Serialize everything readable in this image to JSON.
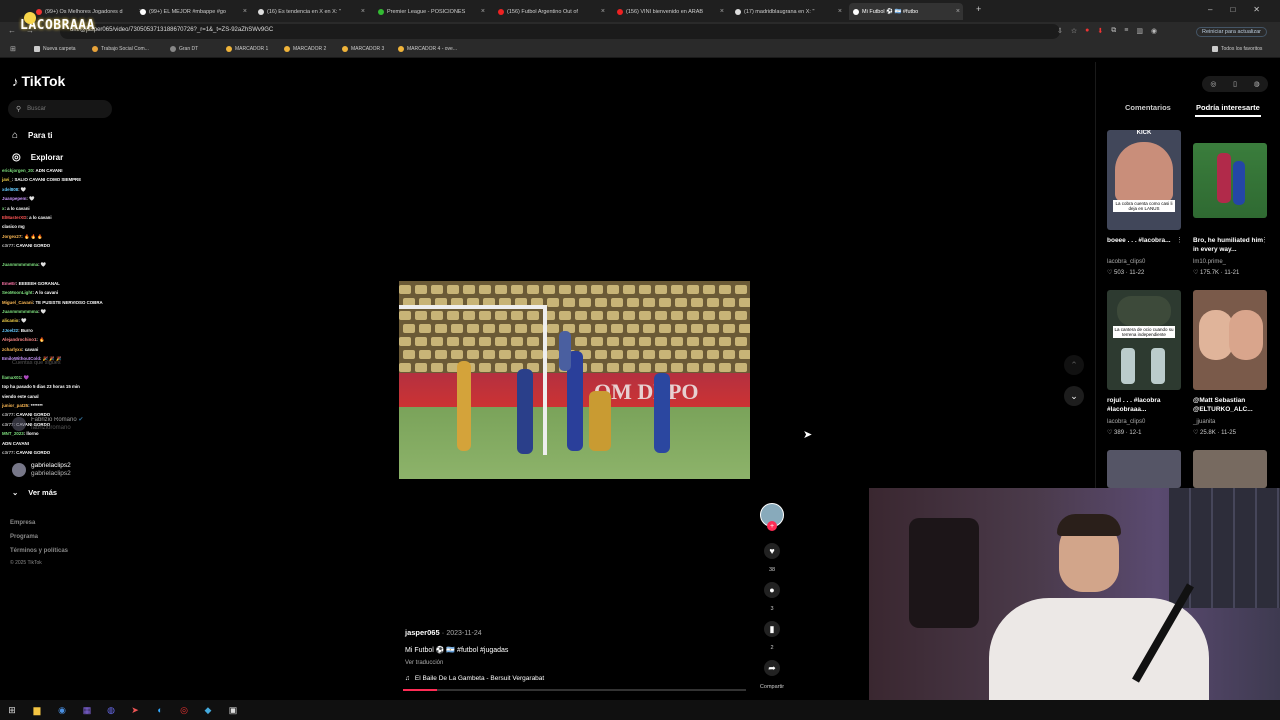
{
  "browser": {
    "tabs": [
      {
        "label": "(99+) Os Melhores Jogadores d",
        "color": "#e33"
      },
      {
        "label": "(99+) EL MEJOR #mbappe #go",
        "color": "#fff"
      },
      {
        "label": "(16) Es tendencia en X en X: \"",
        "color": "#ddd"
      },
      {
        "label": "Premier League - POSICIONES",
        "color": "#3b3"
      },
      {
        "label": "(156) Futbol Argentino Out of",
        "color": "#e22"
      },
      {
        "label": "(156) VINI bienvenido en ARAB",
        "color": "#e22"
      },
      {
        "label": "(17) madridblaugrana en X: \"",
        "color": "#ddd"
      },
      {
        "label": "Mi Futbol ⚽ 🇦🇷 #futbo",
        "color": "#fff"
      }
    ],
    "url": "om/@jasper065/video/7305053713188670726?_r=1&_t=ZS-92aZhSWv9GC",
    "stream_logo": "LACOBRAAA",
    "update_button": "Reiniciar para actualizar",
    "bookmarks": [
      "Nueva carpeta",
      "Trabajo Social Com...",
      "Gran DT",
      "MARCADOR 1",
      "MARCADOR 2",
      "MARCADOR 3",
      "MARCADOR 4 - ove..."
    ],
    "all_bookmarks": "Todos los favoritos"
  },
  "sidebar": {
    "logo": "TikTok",
    "search_placeholder": "Buscar",
    "nav": [
      "Para ti",
      "Explorar"
    ],
    "more": "Ver más",
    "following_label": "Cuentas que sigues",
    "accounts": [
      {
        "name": "Fabrizio Romano",
        "handle": "fabrizioromano"
      },
      {
        "name": "gabrielaclips2",
        "handle": "gabrielaclips2"
      }
    ],
    "footer": [
      "Empresa",
      "Programa",
      "Términos y políticas",
      "© 2025 TikTok"
    ]
  },
  "chat": [
    {
      "user": "erickjorgen_20",
      "msg": "ADN CAVANI",
      "color": "#7ee07e"
    },
    {
      "user": "javi_",
      "msg": "SALIO CAVANI COMO SIEMPRE",
      "color": "#f7d54a"
    },
    {
      "user": "xdel808",
      "msg": "🤍",
      "color": "#6cf"
    },
    {
      "user": "Juanpepem",
      "msg": "🤍",
      "color": "#c9f"
    },
    {
      "user": "x",
      "msg": "a lo cavani",
      "color": "#7ee07e"
    },
    {
      "user": "ElMasterXD",
      "msg": "a lo cavani",
      "color": "#f55"
    },
    {
      "user": "",
      "msg": "clasico mg",
      "color": "#f88"
    },
    {
      "user": "Jorgex27",
      "msg": "🔥 🔥 🔥",
      "color": "#fb5"
    },
    {
      "user": "c3r77",
      "msg": "CAVANI GORDO",
      "color": "#bbb"
    },
    {
      "user": "",
      "msg": "",
      "color": "#f55"
    },
    {
      "user": "Juanmmmmmma",
      "msg": "🤍",
      "color": "#7ee07e"
    },
    {
      "user": "",
      "msg": "",
      "color": "#c9f"
    },
    {
      "user": "EmeEr",
      "msg": "EEEEEH GORANAL",
      "color": "#f7a"
    },
    {
      "user": "SeoMoonLight",
      "msg": "A lo cavani",
      "color": "#7ee07e"
    },
    {
      "user": "Miguel_Cavani",
      "msg": "TE PUSISTE NERVIOSO COBRA",
      "color": "#fb5"
    },
    {
      "user": "Juanmmmmmma",
      "msg": "🤍",
      "color": "#7ee07e"
    },
    {
      "user": "alicanio",
      "msg": "🤍",
      "color": "#f7d54a"
    },
    {
      "user": "JJoel22",
      "msg": "Burro",
      "color": "#6cf"
    },
    {
      "user": "Alejandrochino1",
      "msg": "🔥",
      "color": "#f88"
    },
    {
      "user": "zcharlyxx",
      "msg": "cavani",
      "color": "#fb5"
    },
    {
      "user": "EmiloWithoutCold",
      "msg": "🎉 🎉 🎉",
      "color": "#c9f"
    },
    {
      "user": "",
      "msg": "",
      "color": "#f55"
    },
    {
      "user": "llamaX01",
      "msg": "💜",
      "color": "#7ee07e"
    },
    {
      "user": "",
      "msg": "top ha pasado 5 dias 23 horas 15 min",
      "color": "#6cf"
    },
    {
      "user": "",
      "msg": "viendo este canal",
      "color": "#bbb"
    },
    {
      "user": "junior_pat25",
      "msg": "*******",
      "color": "#fb5"
    },
    {
      "user": "c3r77",
      "msg": "CAVANI GORDO",
      "color": "#bbb"
    },
    {
      "user": "c3r77",
      "msg": "CAVANI GORDO",
      "color": "#bbb"
    },
    {
      "user": "MNT_2023",
      "msg": "llorno",
      "color": "#7ee07e"
    },
    {
      "user": "",
      "msg": "ADN CAVANI",
      "color": "#f88"
    },
    {
      "user": "c3r77",
      "msg": "CAVANI GORDO",
      "color": "#bbb"
    }
  ],
  "video": {
    "author": "jasper065",
    "date": "2023-11-24",
    "caption": "Mi Futbol ⚽ 🇦🇷 #futbol #jugadas",
    "translate": "Ver traducción",
    "music": "El Baile De La Gambeta - Bersuit Vergarabat",
    "progress": 0.1,
    "actions": {
      "likes": "38",
      "comments": "3",
      "saves": "2",
      "share": "Compartir"
    }
  },
  "right_panel": {
    "tabs": [
      "Comentarios",
      "Podría interesarte"
    ],
    "cards": [
      {
        "title": "boeee . . . #lacobra...",
        "user": "lacobra_clips0",
        "likes": "503",
        "date": "11-22",
        "thumb_text": "La cobra cuenta como casi li deja en LANUS"
      },
      {
        "title": "Bro, he humiliated him in every way...",
        "user": "lm10.prime_",
        "likes": "175.7K",
        "date": "11-21",
        "thumb_text": ""
      },
      {
        "title": "rojul . . . #lacobra #lacobraaa...",
        "user": "lacobra_clips0",
        "likes": "389",
        "date": "12-1",
        "thumb_text": "La cantera de ocio cuando su terrena independiente"
      },
      {
        "title": "@Matt Sebastian @ELTURKO_ALC...",
        "user": "_jjuanita",
        "likes": "25.8K",
        "date": "11-25",
        "thumb_text": ""
      }
    ]
  },
  "colors": {
    "accent": "#fe2c55",
    "bg": "#000000"
  }
}
